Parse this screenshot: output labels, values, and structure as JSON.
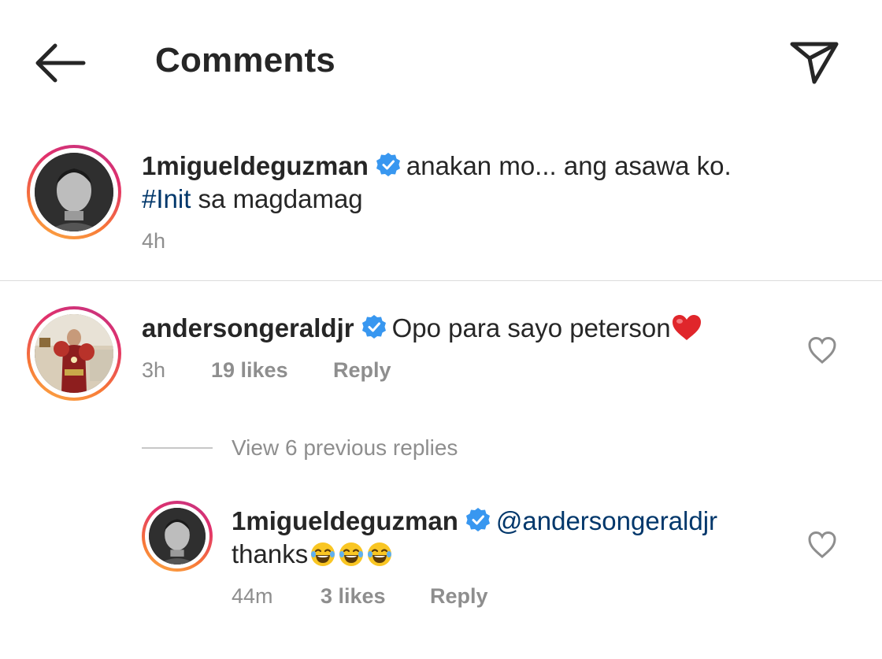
{
  "header": {
    "title": "Comments",
    "back_icon": "arrow-left-icon",
    "share_icon": "paper-plane-icon"
  },
  "caption": {
    "username": "1migueldeguzman",
    "text_part1": "anakan mo... ang asawa ko.",
    "hashtag": "#Init",
    "text_part2": " sa magdamag",
    "time": "4h"
  },
  "comment": {
    "username": "andersongeraldjr",
    "text": "Opo para sayo peterson",
    "emoji": "red-heart",
    "time": "3h",
    "likes": "19 likes",
    "reply_label": "Reply"
  },
  "view_replies": "View 6 previous replies",
  "reply": {
    "username": "1migueldeguzman",
    "mention": "@andersongeraldjr",
    "text": "thanks",
    "emoji": "face-with-tears-of-joy x3",
    "time": "44m",
    "likes": "3 likes",
    "reply_label": "Reply"
  },
  "colors": {
    "text": "#262626",
    "secondary": "#8e8e8e",
    "link": "#00376b",
    "verified": "#3897f0",
    "heart": "#ed4956"
  }
}
